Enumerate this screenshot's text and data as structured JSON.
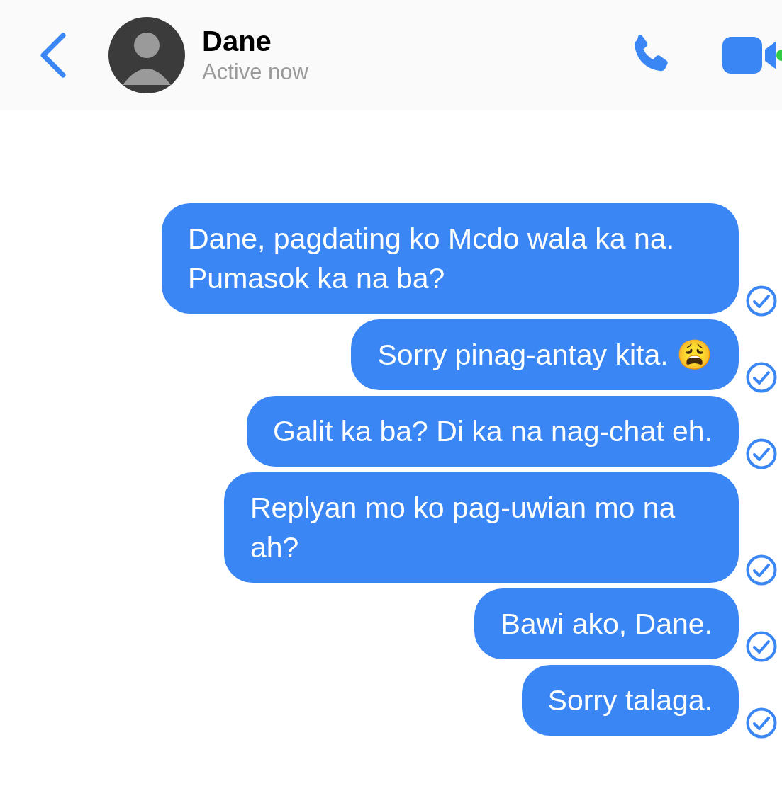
{
  "header": {
    "name": "Dane",
    "status": "Active now",
    "active": true
  },
  "messages": [
    {
      "text": "Dane, pagdating ko Mcdo wala ka na. Pumasok ka na ba?",
      "delivered": true
    },
    {
      "text": "Sorry pinag-antay kita. 😩",
      "delivered": true
    },
    {
      "text": "Galit ka ba? Di ka na nag-chat eh.",
      "delivered": true
    },
    {
      "text": "Replyan mo ko pag-uwian mo na ah?",
      "delivered": true
    },
    {
      "text": "Bawi ako, Dane.",
      "delivered": true
    },
    {
      "text": "Sorry talaga.",
      "delivered": true
    }
  ]
}
